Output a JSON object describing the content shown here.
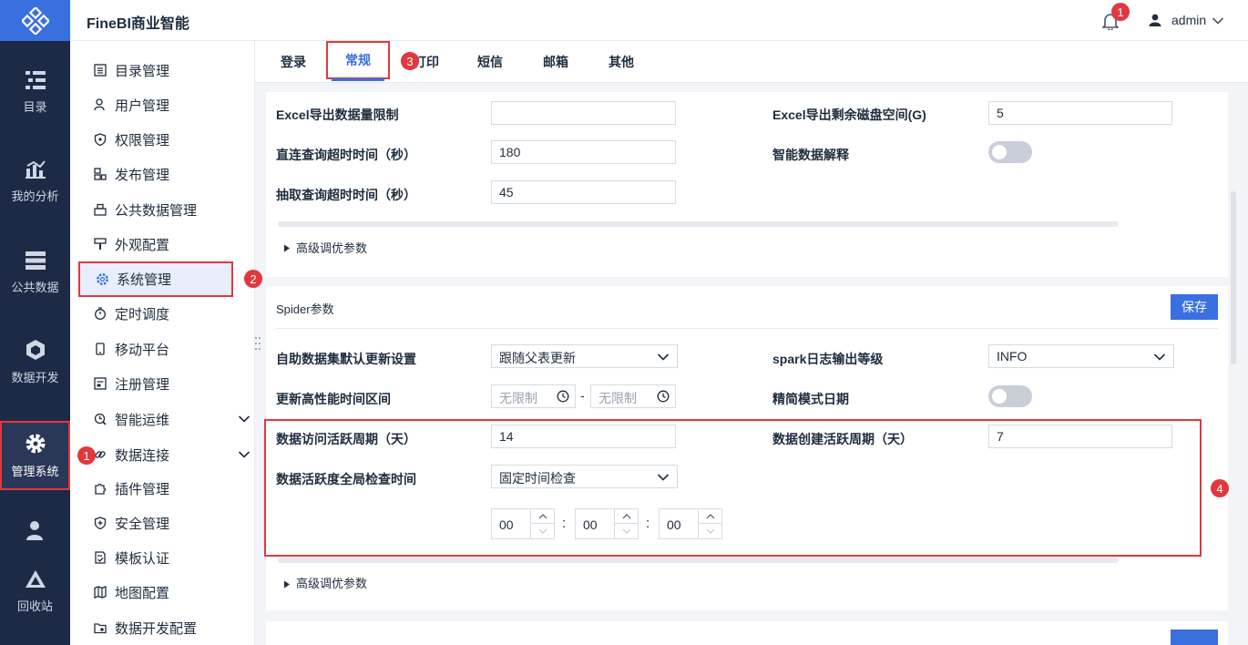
{
  "app": {
    "title": "FineBI商业智能",
    "user": "admin",
    "notification_count": "1"
  },
  "nav": [
    {
      "label": "目录"
    },
    {
      "label": "我的分析"
    },
    {
      "label": "公共数据"
    },
    {
      "label": "数据开发"
    },
    {
      "label": "管理系统"
    },
    {
      "label": ""
    },
    {
      "label": "回收站"
    }
  ],
  "sidebar": [
    {
      "label": "目录管理"
    },
    {
      "label": "用户管理"
    },
    {
      "label": "权限管理"
    },
    {
      "label": "发布管理"
    },
    {
      "label": "公共数据管理"
    },
    {
      "label": "外观配置"
    },
    {
      "label": "系统管理"
    },
    {
      "label": "定时调度"
    },
    {
      "label": "移动平台"
    },
    {
      "label": "注册管理"
    },
    {
      "label": "智能运维"
    },
    {
      "label": "数据连接"
    },
    {
      "label": "插件管理"
    },
    {
      "label": "安全管理"
    },
    {
      "label": "模板认证"
    },
    {
      "label": "地图配置"
    },
    {
      "label": "数据开发配置"
    }
  ],
  "tabs": [
    "登录",
    "常规",
    "打印",
    "短信",
    "邮箱",
    "其他"
  ],
  "callouts": [
    "1",
    "2",
    "3",
    "4"
  ],
  "section1": {
    "excel_limit_label": "Excel导出数据量限制",
    "excel_limit_value": "",
    "excel_disk_label": "Excel导出剩余磁盘空间(G)",
    "excel_disk_value": "5",
    "direct_timeout_label": "直连查询超时时间（秒）",
    "direct_timeout_value": "180",
    "smart_explain_label": "智能数据解释",
    "extract_timeout_label": "抽取查询超时时间（秒）",
    "extract_timeout_value": "45",
    "advanced_label": "高级调优参数"
  },
  "section2": {
    "title": "Spider参数",
    "save_label": "保存",
    "auto_update_label": "自助数据集默认更新设置",
    "auto_update_value": "跟随父表更新",
    "spark_log_label": "spark日志输出等级",
    "spark_log_value": "INFO",
    "perf_range_label": "更新高性能时间区间",
    "perf_start_placeholder": "无限制",
    "perf_end_placeholder": "无限制",
    "range_sep": "-",
    "simple_date_label": "精简模式日期",
    "access_period_label": "数据访问活跃周期（天）",
    "access_period_value": "14",
    "create_period_label": "数据创建活跃周期（天）",
    "create_period_value": "7",
    "check_time_label": "数据活跃度全局检查时间",
    "check_time_value": "固定时间检查",
    "hour": "00",
    "minute": "00",
    "second": "00",
    "time_sep": ":",
    "advanced_label": "高级调优参数"
  }
}
